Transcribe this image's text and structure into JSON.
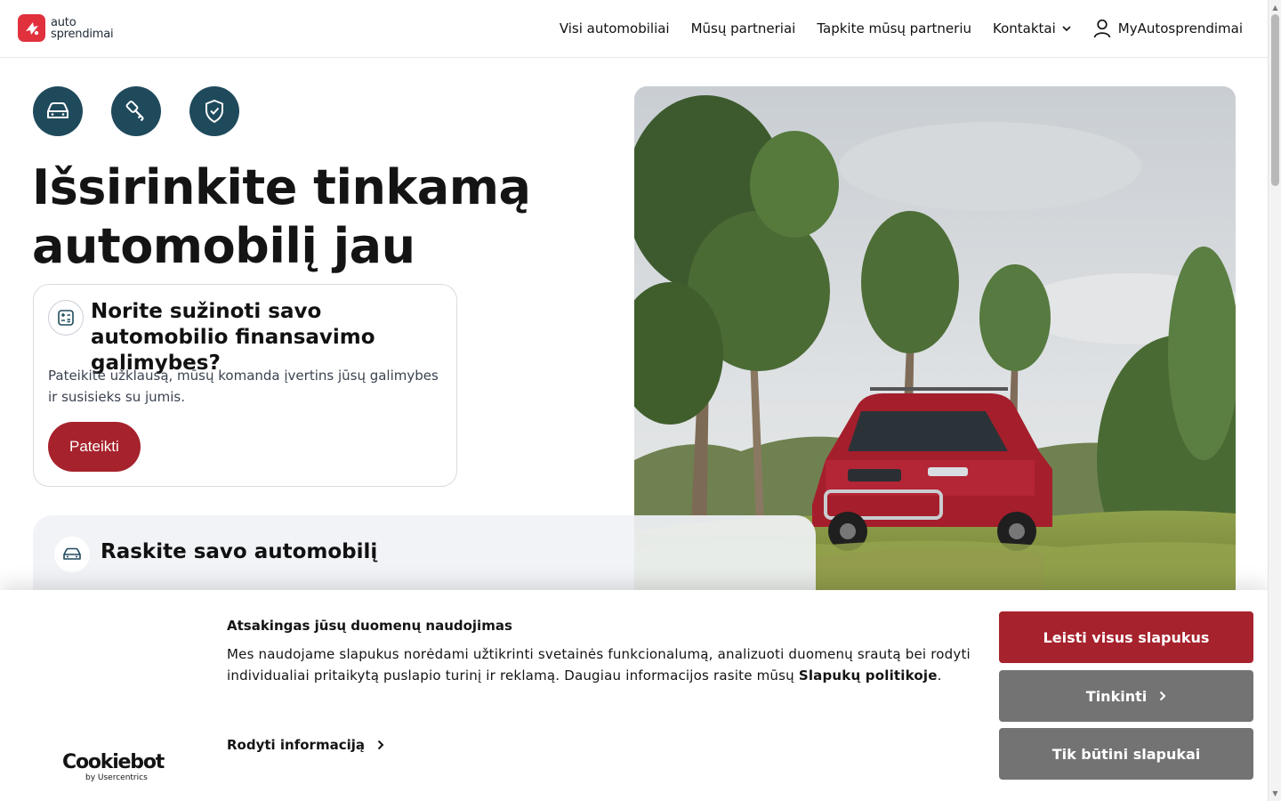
{
  "header": {
    "logo": {
      "line1": "auto",
      "line2": "sprendimai"
    },
    "nav": {
      "all_cars": "Visi automobiliai",
      "partners": "Mūsų partneriai",
      "become_partner": "Tapkite mūsų partneriu",
      "contacts": "Kontaktai",
      "account": "MyAutosprendimai"
    }
  },
  "hero": {
    "icons": [
      "car-icon",
      "key-icon",
      "shield-check-icon"
    ],
    "title": "Išsirinkite tinkamą automobilį jau dabar!"
  },
  "finance_card": {
    "title": "Norite sužinoti savo automobilio finansavimo galimybes?",
    "text": "Pateikite užklausą, mūsų komanda įvertins jūsų galimybes ir susisieks su jumis.",
    "button": "Pateikti"
  },
  "search_panel": {
    "title": "Raskite savo automobilį"
  },
  "cookie_banner": {
    "brand": "Cookiebot",
    "brand_sub": "by Usercentrics",
    "title": "Atsakingas jūsų duomenų naudojimas",
    "text_before_link": "Mes naudojame slapukus norėdami užtikrinti svetainės funkcionalumą, analizuoti duomenų srautą bei rodyti individualiai pritaikytą puslapio turinį ir reklamą. Daugiau informacijos rasite mūsų ",
    "link": "Slapukų politikoje",
    "text_after_link": ".",
    "details": "Rodyti informaciją",
    "buttons": {
      "allow_all": "Leisti visus slapukus",
      "customize": "Tinkinti",
      "necessary_only": "Tik būtini slapukai"
    }
  },
  "colors": {
    "brand_red": "#a6222c",
    "logo_red": "#e0313d",
    "icon_teal": "#1f4a5c",
    "button_gray": "#737373"
  }
}
